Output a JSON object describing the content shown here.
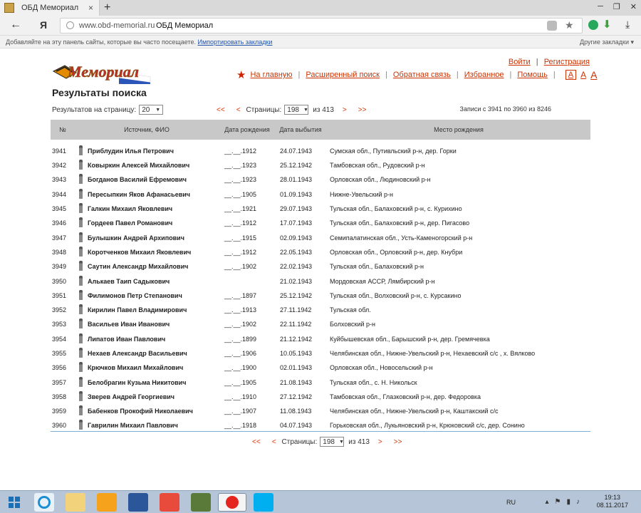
{
  "browser": {
    "tab_title": "ОБД Мемориал",
    "tab_close": "×",
    "new_tab": "+",
    "window_controls": [
      "─",
      "❐",
      "✕"
    ],
    "back": "←",
    "ya": "Я",
    "url_host": "www.obd-memorial.ru",
    "url_title": "ОБД Мемориал",
    "star": "★",
    "download": "⤓",
    "bookmarks_hint": "Добавляйте на эту панель сайты, которые вы часто посещаете.",
    "bookmarks_import": "Импортировать закладки",
    "bookmarks_other": "Другие закладки ▾"
  },
  "header": {
    "logo_text": "Мемориал",
    "login": "Войти",
    "separator": "|",
    "register": "Регистрация",
    "nav": [
      "На главную",
      "Расширенный поиск",
      "Обратная связь",
      "Избранное",
      "Помощь"
    ],
    "font_sizes": [
      "А",
      "А",
      "А"
    ]
  },
  "page": {
    "title": "Результаты поиска",
    "per_page_label": "Результатов на страницу:",
    "per_page_value": "20",
    "first": "<<",
    "prev": "<",
    "pages_label": "Страницы:",
    "current_page": "198",
    "of_total": "из 413",
    "next": ">",
    "last": ">>",
    "records": "Записи с 3941 по 3960 из 8246"
  },
  "table": {
    "headers": [
      "№",
      "Источник, ФИО",
      "Дата рождения",
      "Дата выбытия",
      "Место рождения"
    ],
    "rows": [
      {
        "num": "3941",
        "name": "Приблудин Илья Петрович",
        "birth": "__.__.1912",
        "death": "24.07.1943",
        "place": "Сумская обл., Путивльский р-н, дер. Горки"
      },
      {
        "num": "3942",
        "name": "Ковыркин Алексей Михайлович",
        "birth": "__.__.1923",
        "death": "25.12.1942",
        "place": "Тамбовская обл., Рудовский р-н"
      },
      {
        "num": "3943",
        "name": "Богданов Василий Ефремович",
        "birth": "__.__.1923",
        "death": "28.01.1943",
        "place": "Орловская обл., Людиновский р-н"
      },
      {
        "num": "3944",
        "name": "Пересыпкин Яков Афанасьевич",
        "birth": "__.__.1905",
        "death": "01.09.1943",
        "place": "Нижне-Увельский р-н"
      },
      {
        "num": "3945",
        "name": "Галкин Михаил Яковлевич",
        "birth": "__.__.1921",
        "death": "29.07.1943",
        "place": "Тульская обл., Балаховский р-н, с. Курихино"
      },
      {
        "num": "3946",
        "name": "Гордеев Павел Романович",
        "birth": "__.__.1912",
        "death": "17.07.1943",
        "place": "Тульская обл., Балаховский р-н, дер. Пигасово"
      },
      {
        "num": "3947",
        "name": "Булышкин Андрей Архипович",
        "birth": "__.__.1915",
        "death": "02.09.1943",
        "place": "Семипалатинская обл., Усть-Каменогорский р-н"
      },
      {
        "num": "3948",
        "name": "Коротченков Михаил Яковлевич",
        "birth": "__.__.1912",
        "death": "22.05.1943",
        "place": "Орловская обл., Орловский р-н, дер. Кнубри"
      },
      {
        "num": "3949",
        "name": "Саутин Александр Михайлович",
        "birth": "__.__.1902",
        "death": "22.02.1943",
        "place": "Тульская обл., Балаховский р-н"
      },
      {
        "num": "3950",
        "name": "Алькаев Таип Садыкович",
        "birth": "",
        "death": "21.02.1943",
        "place": "Мордовская АССР, Лямбирский р-н"
      },
      {
        "num": "3951",
        "name": "Филимонов Петр Степанович",
        "birth": "__.__.1897",
        "death": "25.12.1942",
        "place": "Тульская обл., Волховский р-н, с. Курсакино"
      },
      {
        "num": "3952",
        "name": "Кирилин Павел Владимирович",
        "birth": "__.__.1913",
        "death": "27.11.1942",
        "place": "Тульская обл."
      },
      {
        "num": "3953",
        "name": "Васильев Иван Иванович",
        "birth": "__.__.1902",
        "death": "22.11.1942",
        "place": "Болховский р-н"
      },
      {
        "num": "3954",
        "name": "Липатов Иван Павлович",
        "birth": "__.__.1899",
        "death": "21.12.1942",
        "place": "Куйбышевская обл., Барышский р-н, дер. Гремячевка"
      },
      {
        "num": "3955",
        "name": "Нехаев Александр Васильевич",
        "birth": "__.__.1906",
        "death": "10.05.1943",
        "place": "Челябинская обл., Нижне-Увельский р-н, Нехаевский с/с , х. Вялково"
      },
      {
        "num": "3956",
        "name": "Крючков Михаил Михайлович",
        "birth": "__.__.1900",
        "death": "02.01.1943",
        "place": "Орловская обл., Новосельский р-н"
      },
      {
        "num": "3957",
        "name": "Белобрагин Кузьма Никитович",
        "birth": "__.__.1905",
        "death": "21.08.1943",
        "place": "Тульская обл., с. Н. Никольск"
      },
      {
        "num": "3958",
        "name": "Зверев Андрей Георгиевич",
        "birth": "__.__.1910",
        "death": "27.12.1942",
        "place": "Тамбовская обл., Глазковский р-н, дер. Федоровка"
      },
      {
        "num": "3959",
        "name": "Бабенков Прокофий Николаевич",
        "birth": "__.__.1907",
        "death": "11.08.1943",
        "place": "Челябинская обл., Нижне-Увельский р-н, Каштакский с/с"
      },
      {
        "num": "3960",
        "name": "Гаврилин Михаил Павлович",
        "birth": "__.__.1918",
        "death": "04.07.1943",
        "place": "Горьковская обл., Лукьяновский р-н, Крюковский с/с, дер. Сонино"
      }
    ]
  },
  "taskbar": {
    "lang": "RU",
    "time": "19:13",
    "date": "08.11.2017",
    "apps": [
      "start-button",
      "ie-icon",
      "explorer-icon",
      "media-icon",
      "word-icon",
      "yandex-app-icon",
      "photos-icon",
      "yandex-browser-icon",
      "skype-icon"
    ]
  },
  "colors": {
    "link": "#cc3300",
    "header_bg": "#c8c8c8",
    "table_line": "#7bb0d8",
    "taskbar": "#b6c6d8"
  }
}
